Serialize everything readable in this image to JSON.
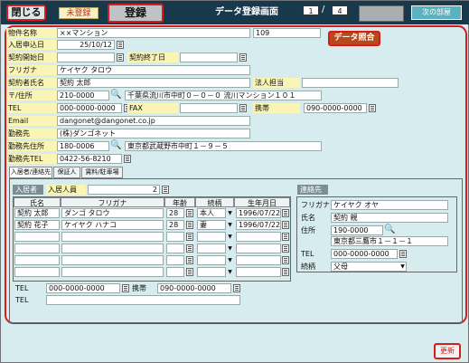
{
  "header": {
    "close_label": "閉じる",
    "unregistered_label": "未登録",
    "register_label": "登録",
    "title": "データ登録画面",
    "page_current": "1",
    "page_sep": "/",
    "page_total": "4",
    "next_label": "次の部屋"
  },
  "property": {
    "name_label": "物件名称",
    "name_value": "××マンション",
    "room_value": "109",
    "move_in_label": "入居申込日",
    "move_in_value": "25/10/12",
    "contract_start_label": "契約開始日",
    "contract_end_label": "契約終了日",
    "furigana_label": "フリガナ",
    "furigana_value": "ケイヤク タロウ",
    "contractor_label": "契約者氏名",
    "contractor_value": "契約 太郎",
    "corp_label": "法人担当",
    "address_label": "〒/住所",
    "zip_value": "210-0000",
    "address_value": "千葉県流川市中町０－０－０ 流川マンション１０１",
    "tel_label": "TEL",
    "tel_value": "000-0000-0000",
    "fax_label": "FAX",
    "mobile_label": "携帯",
    "mobile_value": "090-0000-0000",
    "email_label": "Email",
    "email_value": "dangonet@dangonet.co.jp",
    "work_label": "勤務先",
    "work_value": "(株)ダンゴネット",
    "work_addr_label": "勤務先住所",
    "work_zip_value": "180-0006",
    "work_addr_value": "東京都武蔵野市中町１－９－５",
    "work_tel_label": "勤務先TEL",
    "work_tel_value": "0422-56-8210",
    "datacheck_label": "データ照合"
  },
  "tabs": [
    "入居者/連絡先",
    "保証人",
    "賃料/駐車場"
  ],
  "residents": {
    "header": "入居者",
    "count_label": "入居人員",
    "count_value": "2",
    "col_name": "氏名",
    "col_kana": "フリガナ",
    "col_age": "年齢",
    "col_rel": "続柄",
    "col_dob": "生年月日",
    "rows": [
      {
        "name": "契約 太郎",
        "kana": "ダンゴ タロウ",
        "age": "28",
        "rel": "本人",
        "dob": "1996/07/22"
      },
      {
        "name": "契約 花子",
        "kana": "ケイヤク ハナコ",
        "age": "28",
        "rel": "妻",
        "dob": "1996/07/22"
      },
      {
        "name": "",
        "kana": "",
        "age": "",
        "rel": "",
        "dob": ""
      },
      {
        "name": "",
        "kana": "",
        "age": "",
        "rel": "",
        "dob": ""
      },
      {
        "name": "",
        "kana": "",
        "age": "",
        "rel": "",
        "dob": ""
      },
      {
        "name": "",
        "kana": "",
        "age": "",
        "rel": "",
        "dob": ""
      }
    ],
    "tel_label": "TEL",
    "tel_value": "000-0000-0000",
    "mobile_label": "携帯",
    "mobile_value": "090-0000-0000",
    "tel2_label": "TEL"
  },
  "contact": {
    "header": "連絡先",
    "kana_label": "フリガナ",
    "kana_value": "ケイヤク オヤ",
    "name_label": "氏名",
    "name_value": "契約 親",
    "address_label": "住所",
    "zip_value": "190-0000",
    "address_value": "東京都三鷹市１－１－１",
    "tel_label": "TEL",
    "tel_value": "000-0000-0000",
    "rel_label": "続柄",
    "rel_value": "父母"
  },
  "footer": {
    "update_label": "更新"
  },
  "colors": {
    "accent_red": "#d81c1c",
    "header_bg": "#18384c",
    "panel_bg": "#d6ecef",
    "label_bg": "#faf5b5"
  }
}
